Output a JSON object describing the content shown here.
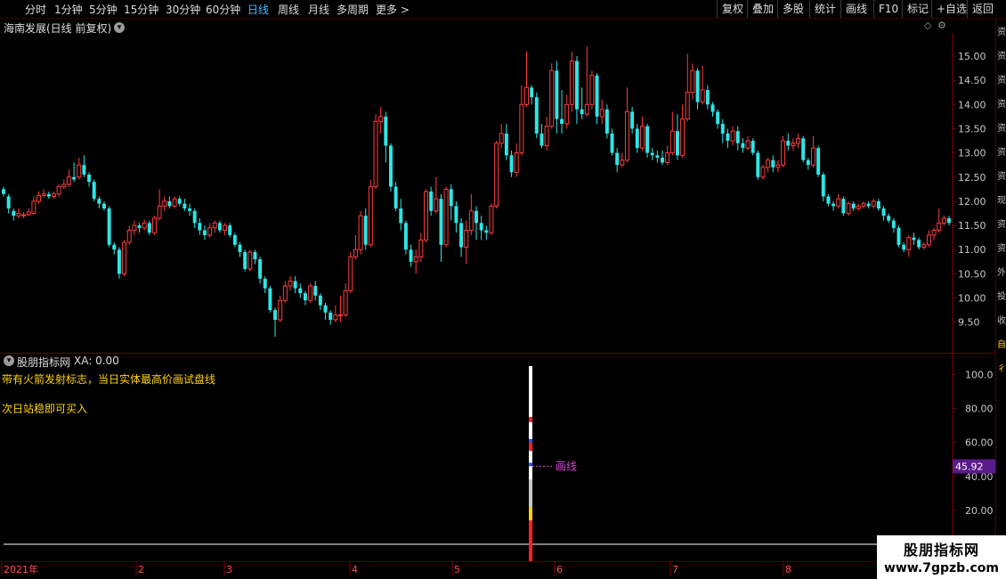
{
  "toolbar": {
    "timeframes": [
      {
        "label": "分时"
      },
      {
        "label": "1分钟"
      },
      {
        "label": "5分钟"
      },
      {
        "label": "15分钟"
      },
      {
        "label": "30分钟"
      },
      {
        "label": "60分钟"
      },
      {
        "label": "日线",
        "active": true
      },
      {
        "label": "周线"
      },
      {
        "label": "月线"
      },
      {
        "label": "多周期"
      },
      {
        "label": "更多 >"
      }
    ],
    "buttons": [
      {
        "label": "复权"
      },
      {
        "label": "叠加"
      },
      {
        "label": "多股"
      },
      {
        "label": "统计"
      },
      {
        "label": "画线"
      },
      {
        "label": "F10"
      },
      {
        "label": "标记"
      },
      {
        "label": "+自选"
      },
      {
        "label": "返回"
      }
    ]
  },
  "main_chart": {
    "title": "海南发展(日线 前复权)",
    "price_axis": [
      "15.00",
      "14.50",
      "14.00",
      "13.50",
      "13.00",
      "12.50",
      "12.00",
      "11.50",
      "11.00",
      "10.50",
      "10.00",
      "9.50"
    ],
    "colors": {
      "up": "#ff3c3c",
      "down": "#2ee6e6",
      "grid": "#3a0000",
      "axis_text": "#c9c9c9"
    }
  },
  "indicator": {
    "title": "股朋指标网",
    "value_label": "XA: 0.00",
    "desc_line1": "带有火箭发射标志，当日实体最高价画试盘线",
    "desc_line2": "次日站稳即可买入",
    "axis": [
      "100.0",
      "80.00",
      "60.00",
      "40.00",
      "20.00"
    ],
    "current_value": "45.92",
    "line_label": "画线"
  },
  "time_axis": {
    "labels": [
      "2021年",
      "2",
      "3",
      "4",
      "5",
      "6",
      "7",
      "8"
    ]
  },
  "sidebar": {
    "chars": [
      "资",
      "资",
      "资",
      "资",
      "资",
      "资",
      "资",
      "现",
      "资",
      "资",
      "外",
      "投",
      "收",
      "自",
      "彳"
    ]
  },
  "watermark": {
    "line1": "股朋指标网",
    "line2": "www.7gpzb.com"
  },
  "chart_data": {
    "type": "candlestick",
    "title": "海南发展(日线 前复权)",
    "ylim": [
      9.2,
      15.35
    ],
    "candles": [
      {
        "o": 12.25,
        "c": 12.15,
        "h": 12.3,
        "l": 12.1
      },
      {
        "o": 12.1,
        "c": 11.85,
        "h": 12.15,
        "l": 11.75
      },
      {
        "o": 11.8,
        "c": 11.7,
        "h": 11.85,
        "l": 11.6
      },
      {
        "o": 11.7,
        "c": 11.75,
        "h": 11.85,
        "l": 11.65
      },
      {
        "o": 11.7,
        "c": 11.72,
        "h": 11.78,
        "l": 11.65
      },
      {
        "o": 11.72,
        "c": 11.78,
        "h": 11.85,
        "l": 11.7
      },
      {
        "o": 11.75,
        "c": 12.0,
        "h": 12.1,
        "l": 11.72
      },
      {
        "o": 12.0,
        "c": 12.12,
        "h": 12.2,
        "l": 11.95
      },
      {
        "o": 12.12,
        "c": 12.15,
        "h": 12.25,
        "l": 12.08
      },
      {
        "o": 12.15,
        "c": 12.1,
        "h": 12.2,
        "l": 12.05
      },
      {
        "o": 12.1,
        "c": 12.15,
        "h": 12.2,
        "l": 12.05
      },
      {
        "o": 12.15,
        "c": 12.3,
        "h": 12.35,
        "l": 12.1
      },
      {
        "o": 12.3,
        "c": 12.35,
        "h": 12.45,
        "l": 12.25
      },
      {
        "o": 12.35,
        "c": 12.5,
        "h": 12.65,
        "l": 12.3
      },
      {
        "o": 12.5,
        "c": 12.45,
        "h": 12.8,
        "l": 12.4
      },
      {
        "o": 12.5,
        "c": 12.75,
        "h": 12.9,
        "l": 12.45
      },
      {
        "o": 12.75,
        "c": 12.55,
        "h": 12.95,
        "l": 12.5
      },
      {
        "o": 12.55,
        "c": 12.4,
        "h": 12.6,
        "l": 12.3
      },
      {
        "o": 12.4,
        "c": 12.05,
        "h": 12.45,
        "l": 12.0
      },
      {
        "o": 12.05,
        "c": 11.95,
        "h": 12.1,
        "l": 11.85
      },
      {
        "o": 11.95,
        "c": 11.85,
        "h": 12.0,
        "l": 11.8
      },
      {
        "o": 11.85,
        "c": 11.1,
        "h": 11.9,
        "l": 11.05
      },
      {
        "o": 11.1,
        "c": 11.0,
        "h": 11.15,
        "l": 10.9
      },
      {
        "o": 11.0,
        "c": 10.5,
        "h": 11.05,
        "l": 10.4
      },
      {
        "o": 10.5,
        "c": 11.15,
        "h": 11.2,
        "l": 10.45
      },
      {
        "o": 11.15,
        "c": 11.4,
        "h": 11.5,
        "l": 11.1
      },
      {
        "o": 11.4,
        "c": 11.5,
        "h": 11.6,
        "l": 11.3
      },
      {
        "o": 11.5,
        "c": 11.45,
        "h": 11.55,
        "l": 11.35
      },
      {
        "o": 11.45,
        "c": 11.55,
        "h": 11.62,
        "l": 11.4
      },
      {
        "o": 11.55,
        "c": 11.35,
        "h": 11.6,
        "l": 11.3
      },
      {
        "o": 11.35,
        "c": 11.65,
        "h": 11.7,
        "l": 11.3
      },
      {
        "o": 11.65,
        "c": 11.9,
        "h": 12.25,
        "l": 11.6
      },
      {
        "o": 11.9,
        "c": 12.0,
        "h": 12.1,
        "l": 11.8
      },
      {
        "o": 12.0,
        "c": 11.9,
        "h": 12.1,
        "l": 11.85
      },
      {
        "o": 11.9,
        "c": 12.05,
        "h": 12.1,
        "l": 11.85
      },
      {
        "o": 12.05,
        "c": 11.95,
        "h": 12.1,
        "l": 11.9
      },
      {
        "o": 11.95,
        "c": 11.85,
        "h": 12.05,
        "l": 11.8
      },
      {
        "o": 11.85,
        "c": 11.8,
        "h": 11.95,
        "l": 11.7
      },
      {
        "o": 11.8,
        "c": 11.55,
        "h": 11.85,
        "l": 11.45
      },
      {
        "o": 11.55,
        "c": 11.4,
        "h": 11.65,
        "l": 11.3
      },
      {
        "o": 11.4,
        "c": 11.3,
        "h": 11.5,
        "l": 11.2
      },
      {
        "o": 11.3,
        "c": 11.45,
        "h": 11.55,
        "l": 11.25
      },
      {
        "o": 11.45,
        "c": 11.55,
        "h": 11.6,
        "l": 11.35
      },
      {
        "o": 11.55,
        "c": 11.4,
        "h": 11.6,
        "l": 11.35
      },
      {
        "o": 11.4,
        "c": 11.5,
        "h": 11.55,
        "l": 11.3
      },
      {
        "o": 11.5,
        "c": 11.3,
        "h": 11.55,
        "l": 11.25
      },
      {
        "o": 11.3,
        "c": 11.1,
        "h": 11.35,
        "l": 11.05
      },
      {
        "o": 11.1,
        "c": 10.95,
        "h": 11.15,
        "l": 10.85
      },
      {
        "o": 10.95,
        "c": 10.6,
        "h": 11.0,
        "l": 10.55
      },
      {
        "o": 10.6,
        "c": 10.95,
        "h": 11.0,
        "l": 10.55
      },
      {
        "o": 10.95,
        "c": 10.8,
        "h": 11.0,
        "l": 10.7
      },
      {
        "o": 10.8,
        "c": 10.4,
        "h": 10.85,
        "l": 10.3
      },
      {
        "o": 10.4,
        "c": 10.2,
        "h": 10.45,
        "l": 10.1
      },
      {
        "o": 10.2,
        "c": 9.75,
        "h": 10.25,
        "l": 9.7
      },
      {
        "o": 9.75,
        "c": 9.55,
        "h": 9.8,
        "l": 9.2
      },
      {
        "o": 9.55,
        "c": 9.95,
        "h": 10.05,
        "l": 9.5
      },
      {
        "o": 9.95,
        "c": 10.25,
        "h": 10.35,
        "l": 9.9
      },
      {
        "o": 10.25,
        "c": 10.35,
        "h": 10.45,
        "l": 10.15
      },
      {
        "o": 10.35,
        "c": 10.2,
        "h": 10.45,
        "l": 10.1
      },
      {
        "o": 10.2,
        "c": 10.1,
        "h": 10.3,
        "l": 10.0
      },
      {
        "o": 10.1,
        "c": 9.95,
        "h": 10.15,
        "l": 9.85
      },
      {
        "o": 9.95,
        "c": 10.25,
        "h": 10.3,
        "l": 9.9
      },
      {
        "o": 10.25,
        "c": 10.05,
        "h": 10.35,
        "l": 9.95
      },
      {
        "o": 10.05,
        "c": 9.85,
        "h": 10.1,
        "l": 9.75
      },
      {
        "o": 9.85,
        "c": 9.7,
        "h": 9.9,
        "l": 9.55
      },
      {
        "o": 9.7,
        "c": 9.55,
        "h": 9.75,
        "l": 9.45
      },
      {
        "o": 9.55,
        "c": 9.65,
        "h": 9.85,
        "l": 9.5
      },
      {
        "o": 9.65,
        "c": 9.65,
        "h": 10.05,
        "l": 9.5
      },
      {
        "o": 9.65,
        "c": 10.15,
        "h": 10.3,
        "l": 9.6
      },
      {
        "o": 10.15,
        "c": 10.85,
        "h": 10.95,
        "l": 10.1
      },
      {
        "o": 10.85,
        "c": 11.0,
        "h": 11.3,
        "l": 10.8
      },
      {
        "o": 11.0,
        "c": 11.7,
        "h": 11.8,
        "l": 10.9
      },
      {
        "o": 11.7,
        "c": 11.1,
        "h": 11.85,
        "l": 11.0
      },
      {
        "o": 11.1,
        "c": 12.3,
        "h": 12.45,
        "l": 11.05
      },
      {
        "o": 12.3,
        "c": 13.65,
        "h": 13.8,
        "l": 12.25
      },
      {
        "o": 13.65,
        "c": 13.75,
        "h": 13.95,
        "l": 13.4
      },
      {
        "o": 13.75,
        "c": 13.15,
        "h": 13.85,
        "l": 12.8
      },
      {
        "o": 13.15,
        "c": 12.3,
        "h": 13.2,
        "l": 12.2
      },
      {
        "o": 12.3,
        "c": 11.85,
        "h": 12.4,
        "l": 11.8
      },
      {
        "o": 11.85,
        "c": 11.55,
        "h": 12.05,
        "l": 11.4
      },
      {
        "o": 11.55,
        "c": 11.0,
        "h": 11.6,
        "l": 10.9
      },
      {
        "o": 11.0,
        "c": 10.75,
        "h": 11.1,
        "l": 10.65
      },
      {
        "o": 10.75,
        "c": 10.85,
        "h": 11.0,
        "l": 10.5
      },
      {
        "o": 10.85,
        "c": 11.2,
        "h": 11.35,
        "l": 10.75
      },
      {
        "o": 11.2,
        "c": 12.2,
        "h": 12.25,
        "l": 11.15
      },
      {
        "o": 12.2,
        "c": 11.8,
        "h": 12.3,
        "l": 11.7
      },
      {
        "o": 11.8,
        "c": 12.05,
        "h": 12.5,
        "l": 11.75
      },
      {
        "o": 12.05,
        "c": 11.1,
        "h": 12.15,
        "l": 10.75
      },
      {
        "o": 11.1,
        "c": 12.25,
        "h": 12.3,
        "l": 11.05
      },
      {
        "o": 12.25,
        "c": 11.9,
        "h": 12.35,
        "l": 11.6
      },
      {
        "o": 11.9,
        "c": 11.55,
        "h": 12.0,
        "l": 11.35
      },
      {
        "o": 11.55,
        "c": 11.05,
        "h": 11.65,
        "l": 10.85
      },
      {
        "o": 11.05,
        "c": 11.4,
        "h": 11.6,
        "l": 10.7
      },
      {
        "o": 11.4,
        "c": 11.8,
        "h": 12.15,
        "l": 11.3
      },
      {
        "o": 11.8,
        "c": 11.55,
        "h": 11.9,
        "l": 11.2
      },
      {
        "o": 11.55,
        "c": 11.4,
        "h": 11.7,
        "l": 11.2
      },
      {
        "o": 11.4,
        "c": 11.35,
        "h": 11.5,
        "l": 11.2
      },
      {
        "o": 11.35,
        "c": 11.9,
        "h": 11.95,
        "l": 11.3
      },
      {
        "o": 11.9,
        "c": 13.2,
        "h": 13.25,
        "l": 11.85
      },
      {
        "o": 13.2,
        "c": 13.4,
        "h": 13.6,
        "l": 13.1
      },
      {
        "o": 13.4,
        "c": 12.95,
        "h": 13.6,
        "l": 12.85
      },
      {
        "o": 12.95,
        "c": 12.6,
        "h": 13.05,
        "l": 12.5
      },
      {
        "o": 12.6,
        "c": 13.0,
        "h": 13.2,
        "l": 12.5
      },
      {
        "o": 13.0,
        "c": 14.0,
        "h": 14.4,
        "l": 12.95
      },
      {
        "o": 14.0,
        "c": 14.35,
        "h": 15.1,
        "l": 13.95
      },
      {
        "o": 14.35,
        "c": 14.15,
        "h": 14.4,
        "l": 14.0
      },
      {
        "o": 14.15,
        "c": 13.4,
        "h": 14.25,
        "l": 13.3
      },
      {
        "o": 13.4,
        "c": 13.15,
        "h": 13.6,
        "l": 13.1
      },
      {
        "o": 13.15,
        "c": 13.55,
        "h": 13.75,
        "l": 13.05
      },
      {
        "o": 13.55,
        "c": 14.7,
        "h": 14.85,
        "l": 13.5
      },
      {
        "o": 14.7,
        "c": 13.7,
        "h": 14.9,
        "l": 13.4
      },
      {
        "o": 13.7,
        "c": 13.6,
        "h": 14.3,
        "l": 13.4
      },
      {
        "o": 13.6,
        "c": 14.0,
        "h": 14.2,
        "l": 13.5
      },
      {
        "o": 14.0,
        "c": 14.9,
        "h": 15.1,
        "l": 13.85
      },
      {
        "o": 14.9,
        "c": 13.9,
        "h": 15.0,
        "l": 13.6
      },
      {
        "o": 13.9,
        "c": 13.8,
        "h": 14.35,
        "l": 13.7
      },
      {
        "o": 13.8,
        "c": 14.0,
        "h": 15.2,
        "l": 13.75
      },
      {
        "o": 14.0,
        "c": 14.6,
        "h": 14.7,
        "l": 13.9
      },
      {
        "o": 14.6,
        "c": 13.75,
        "h": 14.65,
        "l": 13.6
      },
      {
        "o": 13.75,
        "c": 13.9,
        "h": 14.1,
        "l": 13.6
      },
      {
        "o": 13.9,
        "c": 13.4,
        "h": 14.0,
        "l": 13.3
      },
      {
        "o": 13.4,
        "c": 13.0,
        "h": 13.5,
        "l": 12.95
      },
      {
        "o": 13.0,
        "c": 12.75,
        "h": 13.1,
        "l": 12.6
      },
      {
        "o": 12.75,
        "c": 12.85,
        "h": 13.0,
        "l": 12.7
      },
      {
        "o": 12.85,
        "c": 13.85,
        "h": 14.35,
        "l": 12.8
      },
      {
        "o": 13.85,
        "c": 13.5,
        "h": 13.95,
        "l": 13.4
      },
      {
        "o": 13.5,
        "c": 13.1,
        "h": 13.6,
        "l": 13.0
      },
      {
        "o": 13.1,
        "c": 13.55,
        "h": 13.75,
        "l": 13.05
      },
      {
        "o": 13.55,
        "c": 13.0,
        "h": 13.6,
        "l": 12.9
      },
      {
        "o": 13.0,
        "c": 12.95,
        "h": 13.1,
        "l": 12.85
      },
      {
        "o": 12.95,
        "c": 12.9,
        "h": 13.05,
        "l": 12.8
      },
      {
        "o": 12.9,
        "c": 12.8,
        "h": 13.05,
        "l": 12.75
      },
      {
        "o": 12.8,
        "c": 13.0,
        "h": 13.15,
        "l": 12.75
      },
      {
        "o": 13.0,
        "c": 13.45,
        "h": 13.85,
        "l": 12.95
      },
      {
        "o": 13.45,
        "c": 12.95,
        "h": 13.8,
        "l": 12.85
      },
      {
        "o": 12.95,
        "c": 13.7,
        "h": 14.0,
        "l": 12.9
      },
      {
        "o": 13.7,
        "c": 14.25,
        "h": 15.05,
        "l": 13.65
      },
      {
        "o": 14.25,
        "c": 14.7,
        "h": 14.85,
        "l": 14.1
      },
      {
        "o": 14.7,
        "c": 14.05,
        "h": 14.75,
        "l": 13.9
      },
      {
        "o": 14.05,
        "c": 14.3,
        "h": 14.8,
        "l": 14.0
      },
      {
        "o": 14.3,
        "c": 14.0,
        "h": 14.4,
        "l": 13.9
      },
      {
        "o": 14.0,
        "c": 13.85,
        "h": 14.05,
        "l": 13.75
      },
      {
        "o": 13.85,
        "c": 13.6,
        "h": 13.9,
        "l": 13.5
      },
      {
        "o": 13.6,
        "c": 13.4,
        "h": 13.7,
        "l": 13.2
      },
      {
        "o": 13.4,
        "c": 13.25,
        "h": 13.5,
        "l": 13.1
      },
      {
        "o": 13.25,
        "c": 13.45,
        "h": 13.55,
        "l": 13.15
      },
      {
        "o": 13.45,
        "c": 13.2,
        "h": 13.55,
        "l": 13.05
      },
      {
        "o": 13.2,
        "c": 13.1,
        "h": 13.3,
        "l": 13.0
      },
      {
        "o": 13.1,
        "c": 13.25,
        "h": 13.35,
        "l": 13.05
      },
      {
        "o": 13.25,
        "c": 13.0,
        "h": 13.3,
        "l": 12.95
      },
      {
        "o": 13.0,
        "c": 12.5,
        "h": 13.05,
        "l": 12.45
      },
      {
        "o": 12.5,
        "c": 12.7,
        "h": 12.75,
        "l": 12.45
      },
      {
        "o": 12.7,
        "c": 12.85,
        "h": 12.9,
        "l": 12.6
      },
      {
        "o": 12.85,
        "c": 12.7,
        "h": 12.95,
        "l": 12.6
      },
      {
        "o": 12.7,
        "c": 12.75,
        "h": 12.85,
        "l": 12.6
      },
      {
        "o": 12.75,
        "c": 13.25,
        "h": 13.35,
        "l": 12.7
      },
      {
        "o": 13.25,
        "c": 13.15,
        "h": 13.4,
        "l": 13.05
      },
      {
        "o": 13.15,
        "c": 13.2,
        "h": 13.3,
        "l": 13.05
      },
      {
        "o": 13.2,
        "c": 13.3,
        "h": 13.4,
        "l": 13.1
      },
      {
        "o": 13.3,
        "c": 12.85,
        "h": 13.35,
        "l": 12.8
      },
      {
        "o": 12.85,
        "c": 12.75,
        "h": 12.9,
        "l": 12.65
      },
      {
        "o": 12.75,
        "c": 13.1,
        "h": 13.35,
        "l": 12.7
      },
      {
        "o": 13.1,
        "c": 12.55,
        "h": 13.15,
        "l": 12.5
      },
      {
        "o": 12.55,
        "c": 12.1,
        "h": 12.6,
        "l": 12.0
      },
      {
        "o": 12.1,
        "c": 11.95,
        "h": 12.15,
        "l": 11.9
      },
      {
        "o": 11.95,
        "c": 11.9,
        "h": 12.0,
        "l": 11.8
      },
      {
        "o": 11.9,
        "c": 12.05,
        "h": 12.15,
        "l": 11.85
      },
      {
        "o": 12.05,
        "c": 11.75,
        "h": 12.1,
        "l": 11.7
      },
      {
        "o": 11.75,
        "c": 11.95,
        "h": 12.0,
        "l": 11.7
      },
      {
        "o": 11.95,
        "c": 11.85,
        "h": 12.0,
        "l": 11.8
      },
      {
        "o": 11.85,
        "c": 11.9,
        "h": 11.95,
        "l": 11.8
      },
      {
        "o": 11.9,
        "c": 11.95,
        "h": 12.0,
        "l": 11.85
      },
      {
        "o": 11.95,
        "c": 11.9,
        "h": 12.0,
        "l": 11.85
      },
      {
        "o": 11.9,
        "c": 12.0,
        "h": 12.05,
        "l": 11.85
      },
      {
        "o": 12.0,
        "c": 11.85,
        "h": 12.05,
        "l": 11.8
      },
      {
        "o": 11.85,
        "c": 11.7,
        "h": 11.9,
        "l": 11.6
      },
      {
        "o": 11.7,
        "c": 11.6,
        "h": 11.75,
        "l": 11.55
      },
      {
        "o": 11.6,
        "c": 11.45,
        "h": 11.65,
        "l": 11.35
      },
      {
        "o": 11.45,
        "c": 11.1,
        "h": 11.5,
        "l": 11.05
      },
      {
        "o": 11.1,
        "c": 11.0,
        "h": 11.15,
        "l": 10.95
      },
      {
        "o": 11.0,
        "c": 11.25,
        "h": 11.3,
        "l": 10.85
      },
      {
        "o": 11.25,
        "c": 11.2,
        "h": 11.35,
        "l": 11.1
      },
      {
        "o": 11.2,
        "c": 11.05,
        "h": 11.25,
        "l": 11.0
      },
      {
        "o": 11.05,
        "c": 11.1,
        "h": 11.15,
        "l": 11.0
      },
      {
        "o": 11.1,
        "c": 11.3,
        "h": 11.4,
        "l": 11.05
      },
      {
        "o": 11.3,
        "c": 11.4,
        "h": 11.45,
        "l": 11.2
      },
      {
        "o": 11.4,
        "c": 11.55,
        "h": 11.85,
        "l": 11.35
      },
      {
        "o": 11.55,
        "c": 11.65,
        "h": 11.7,
        "l": 11.5
      },
      {
        "o": 11.65,
        "c": 11.55,
        "h": 11.7,
        "l": 11.5
      }
    ],
    "indicator_xa": 0.0,
    "indicator_current": 45.92,
    "indicator_ylim": [
      0,
      105
    ]
  }
}
